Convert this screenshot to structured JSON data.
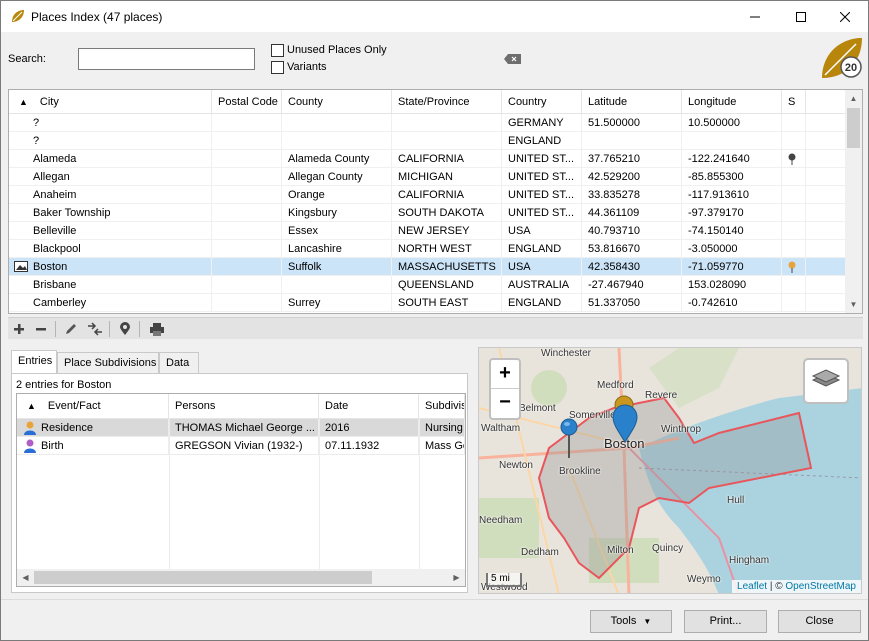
{
  "window": {
    "title": "Places Index (47 places)"
  },
  "search": {
    "label": "Search:",
    "value": "",
    "placeholder": "",
    "unused_only_label": "Unused Places Only",
    "unused_only_checked": false,
    "variants_label": "Variants",
    "variants_checked": false
  },
  "logo": {
    "text": "20"
  },
  "places_table": {
    "columns": [
      "City",
      "Postal Code",
      "County",
      "State/Province",
      "Country",
      "Latitude",
      "Longitude",
      "S"
    ],
    "sort_column": "City",
    "rows": [
      {
        "city": "?",
        "postal": "",
        "county": "",
        "state": "",
        "country": "GERMANY",
        "lat": "51.500000",
        "lon": "10.500000",
        "s": "",
        "selected": false
      },
      {
        "city": "?",
        "postal": "",
        "county": "",
        "state": "",
        "country": "ENGLAND",
        "lat": "",
        "lon": "",
        "s": "",
        "selected": false
      },
      {
        "city": "Alameda",
        "postal": "",
        "county": "Alameda County",
        "state": "CALIFORNIA",
        "country": "UNITED ST...",
        "lat": "37.765210",
        "lon": "-122.241640",
        "s": "pin-dark",
        "selected": false
      },
      {
        "city": "Allegan",
        "postal": "",
        "county": "Allegan County",
        "state": "MICHIGAN",
        "country": "UNITED ST...",
        "lat": "42.529200",
        "lon": "-85.855300",
        "s": "",
        "selected": false
      },
      {
        "city": "Anaheim",
        "postal": "",
        "county": "Orange",
        "state": "CALIFORNIA",
        "country": "UNITED ST...",
        "lat": "33.835278",
        "lon": "-117.913610",
        "s": "",
        "selected": false
      },
      {
        "city": "Baker Township",
        "postal": "",
        "county": "Kingsbury",
        "state": "SOUTH DAKOTA",
        "country": "UNITED ST...",
        "lat": "44.361109",
        "lon": "-97.379170",
        "s": "",
        "selected": false
      },
      {
        "city": "Belleville",
        "postal": "",
        "county": "Essex",
        "state": "NEW JERSEY",
        "country": "USA",
        "lat": "40.793710",
        "lon": "-74.150140",
        "s": "",
        "selected": false
      },
      {
        "city": "Blackpool",
        "postal": "",
        "county": "Lancashire",
        "state": "NORTH WEST",
        "country": "ENGLAND",
        "lat": "53.816670",
        "lon": "-3.050000",
        "s": "",
        "selected": false
      },
      {
        "city": "Boston",
        "postal": "",
        "county": "Suffolk",
        "state": "MASSACHUSETTS",
        "country": "USA",
        "lat": "42.358430",
        "lon": "-71.059770",
        "s": "pin-orange",
        "selected": true
      },
      {
        "city": "Brisbane",
        "postal": "",
        "county": "",
        "state": "QUEENSLAND",
        "country": "AUSTRALIA",
        "lat": "-27.467940",
        "lon": "153.028090",
        "s": "",
        "selected": false
      },
      {
        "city": "Camberley",
        "postal": "",
        "county": "Surrey",
        "state": "SOUTH EAST",
        "country": "ENGLAND",
        "lat": "51.337050",
        "lon": "-0.742610",
        "s": "",
        "selected": false
      }
    ]
  },
  "tabs": [
    "Entries",
    "Place Subdivisions",
    "Data"
  ],
  "active_tab": "Entries",
  "entries": {
    "count_text": "2 entries for Boston",
    "columns": [
      "Event/Fact",
      "Persons",
      "Date",
      "Subdivis"
    ],
    "rows": [
      {
        "event": "Residence",
        "persons": "THOMAS Michael George ...",
        "date": "2016",
        "subdivision": "Nursing",
        "selected": true,
        "icon_color": "#e8a33d"
      },
      {
        "event": "Birth",
        "persons": "GREGSON Vivian (1932-)",
        "date": "07.11.1932",
        "subdivision": "Mass Ge",
        "selected": false,
        "icon_color": "#b05ec7"
      }
    ]
  },
  "map": {
    "labels": [
      "Winchester",
      "Medford",
      "Revere",
      "Belmont",
      "Somerville",
      "Waltham",
      "Boston",
      "Winthrop",
      "Newton",
      "Brookline",
      "Hull",
      "Needham",
      "Milton",
      "Quincy",
      "Dedham",
      "Hingham",
      "Weymo",
      "Westwood"
    ],
    "zoom_in": "+",
    "zoom_out": "−",
    "scale": "5 mi",
    "attribution_leaflet": "Leaflet",
    "attribution_sep": " | © ",
    "attribution_osm": "OpenStreetMap"
  },
  "buttons": {
    "tools": "Tools",
    "print": "Print...",
    "close": "Close"
  }
}
